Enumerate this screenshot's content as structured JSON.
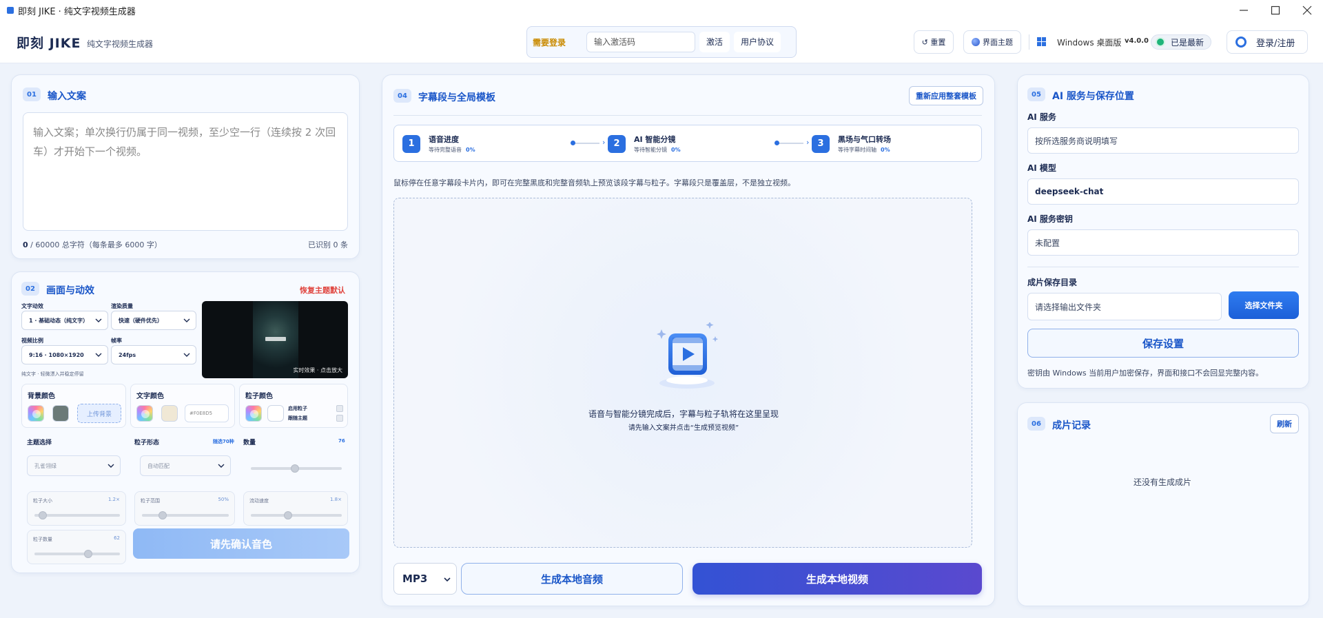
{
  "window": {
    "title": "即刻 JIKE · 纯文字视频生成器"
  },
  "header": {
    "brand": "即刻 JIKE",
    "subtitle": "纯文字视频生成器",
    "need_login": "需要登录",
    "code_placeholder": "输入激活码",
    "activate": "激活",
    "agreement": "用户协议",
    "reset": "↺ 重置",
    "theme": "界面主题",
    "platform": "Windows 桌面版",
    "version": "v4.0.0",
    "latest": "已是最新",
    "login": "登录/注册"
  },
  "card01": {
    "badge": "01",
    "title": "输入文案",
    "placeholder": "输入文案；单次换行仍属于同一视频，至少空一行（连续按 2 次回车）才开始下一个视频。",
    "count_num": "0",
    "count_rest": " / 60000 总字符（每条最多 6000 字）",
    "recognized": "已识别 0 条"
  },
  "card02": {
    "badge": "02",
    "title": "画面与动效",
    "restore": "恢复主题默认",
    "text_anim_label": "文字动效",
    "text_anim_value": "1 · 基础动态（纯文字）",
    "render_label": "渲染质量",
    "render_value": "快速（硬件优先）",
    "ratio_label": "视频比例",
    "ratio_value": "9:16 · 1080×1920",
    "fps_label": "帧率",
    "fps_value": "24fps",
    "hint": "纯文字 · 轻微漂入并稳定停留",
    "preview_caption": "实时效果 · 点击放大",
    "bg_color": "背景颜色",
    "upload_bg": "上传背景",
    "text_color": "文字颜色",
    "text_hex": "#F0E8D5",
    "particle_color": "粒子颜色",
    "enable_particles": "启用粒子",
    "follow_theme": "跟随主题",
    "theme_select_label": "主题选择",
    "theme_select_value": "孔雀翎绿",
    "particle_shape_label": "粒子形态",
    "particle_shape_count": "随选70种",
    "particle_shape_value": "自动匹配",
    "count_label": "数量",
    "count_value": "76",
    "size_label": "粒子大小",
    "size_value": "1.2×",
    "range_label": "粒子范围",
    "range_value": "50%",
    "speed_label": "流动速度",
    "speed_value": "1.8×",
    "density_label": "粒子数量",
    "density_value": "62",
    "confirm_voice": "请先确认音色"
  },
  "card04": {
    "badge": "04",
    "title": "字幕段与全局模板",
    "reapply": "重新应用整套模板",
    "steps": [
      {
        "num": "1",
        "title": "语音进度",
        "sub": "等待完整语音",
        "pct": "0%"
      },
      {
        "num": "2",
        "title": "AI 智能分镜",
        "sub": "等待智能分镜",
        "pct": "0%"
      },
      {
        "num": "3",
        "title": "黑场与气口转场",
        "sub": "等待字幕时间轴",
        "pct": "0%"
      }
    ],
    "hover_tip": "鼠标停在任意字幕段卡片内，即可在完整黑底和完整音频轨上预览该段字幕与粒子。字幕段只是覆盖层，不是独立视频。",
    "empty_title": "语音与智能分镜完成后，字幕与粒子轨将在这里呈现",
    "empty_sub": "请先输入文案并点击“生成预览视频”",
    "format": "MP3",
    "gen_audio": "生成本地音频",
    "gen_video": "生成本地视频"
  },
  "card05": {
    "badge": "05",
    "title": "AI 服务与保存位置",
    "service_label": "AI 服务",
    "service_placeholder": "按所选服务商说明填写",
    "model_label": "AI 模型",
    "model_value": "deepseek-chat",
    "key_label": "AI 服务密钥",
    "key_value": "未配置",
    "dir_label": "成片保存目录",
    "dir_placeholder": "请选择输出文件夹",
    "choose_folder": "选择文件夹",
    "save": "保存设置",
    "note": "密钥由 Windows 当前用户加密保存，界面和接口不会回显完整内容。"
  },
  "card06": {
    "badge": "06",
    "title": "成片记录",
    "refresh": "刷新",
    "empty": "还没有生成成片"
  },
  "colors": {
    "accent": "#1a56c8",
    "primary": "#2b6fe0",
    "danger": "#e0453f",
    "bg_swatch": "#6b7a78",
    "text_swatch": "#F0E8D5",
    "particle_swatch": "#ffffff"
  }
}
